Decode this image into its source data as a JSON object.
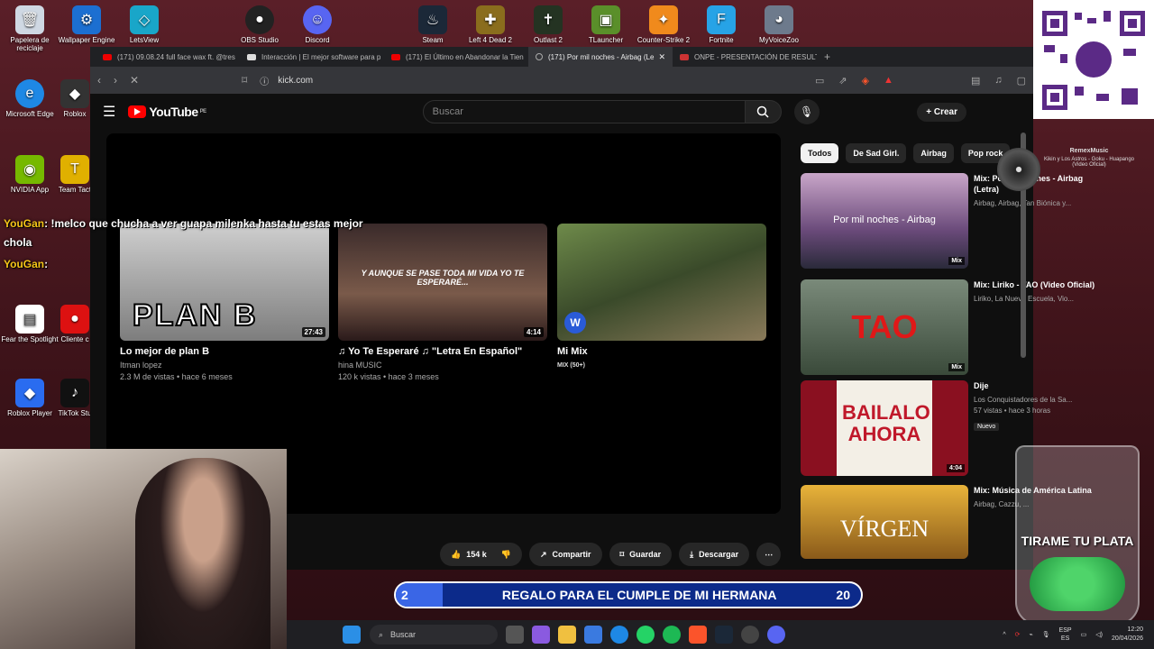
{
  "desktop": {
    "top_icons": [
      "Papelera de reciclaje",
      "Wallpaper Engine",
      "LetsView",
      "OBS Studio",
      "Discord",
      "Steam",
      "Left 4 Dead 2",
      "Outlast 2",
      "TLauncher",
      "Counter-Strike 2",
      "Fortnite",
      "MyVoiceZoo"
    ],
    "left_icons": [
      "Microsoft Edge",
      "Roblox",
      "NVIDIA App",
      "Team Tact",
      "Fear the Spotlight",
      "Cliente c",
      "Roblox Player",
      "TikTok Stu"
    ]
  },
  "browser": {
    "tabs": [
      "(171) 09.08.24 full face wax ft. @tres",
      "Interacción | El mejor software para p",
      "(171) El Último en Abandonar la Tien",
      "(171) Por mil noches - Airbag (Le",
      "ONPE - PRESENTACIÓN DE RESULTAI"
    ],
    "active_tab": 3,
    "url": "kick.com"
  },
  "youtube": {
    "logo": "YouTube",
    "region": "PE",
    "search_placeholder": "Buscar",
    "create_label": "Crear",
    "endcards": [
      {
        "title": "Lo mejor de plan B",
        "channel": "Itman lopez",
        "meta": "2.3 M de vistas • hace 6 meses",
        "duration": "27:43",
        "thumb_text": "PLAN B"
      },
      {
        "title": "♫ Yo Te Esperaré ♫ \"Letra En Español\"",
        "channel": "hina MUSIC",
        "meta": "120 k vistas • hace 3 meses",
        "duration": "4:14",
        "thumb_text": "Y AUNQUE SE PASE TODA MI VIDA YO TE ESPERARÉ..."
      },
      {
        "title": "Mi Mix",
        "channel": "MIX (50+)",
        "meta": "",
        "duration": "",
        "thumb_text": ""
      }
    ],
    "actions": {
      "likes": "154 k",
      "share": "Compartir",
      "save": "Guardar",
      "download": "Descargar"
    },
    "chips": [
      "Todos",
      "De Sad Girl.",
      "Airbag",
      "Pop rock"
    ],
    "related": [
      {
        "title": "Mix: Por mil noches - Airbag (Letra)",
        "meta": "Airbag, Airbag, Tan Biónica y...",
        "tag": "Mix",
        "thumb_text": "Por mil noches - Airbag"
      },
      {
        "title": "Mix: Liriko - TAO (Video Oficial)",
        "meta": "Liriko, La Nueva Escuela, Vio...",
        "tag": "Mix",
        "thumb_text": "TAO"
      },
      {
        "title": "Dije",
        "meta": "Los Conquistadores de la Sa...",
        "meta2": "57 vistas • hace 3 horas",
        "badge": "Nuevo",
        "tag": "4:04",
        "thumb_text": "BAILALO AHORA"
      },
      {
        "title": "Mix: Música de América Latina",
        "meta": "Airbag, Cazzu, ...",
        "tag": "",
        "thumb_text": "VÍRGEN"
      }
    ]
  },
  "overlay": {
    "chat1_name": "YouGan",
    "chat1_text": ": !melco que chucha a ver guapa milenka hasta tu estas mejor",
    "chat2_text": "chola",
    "chat3_name": "YouGan",
    "chat3_text": ":",
    "remex_title": "RemexMusic",
    "remex_song": "Kikin y Los Astros - Goku - Huapango (Video Oficial)",
    "goal_current": "2",
    "goal_text": "REGALO PARA EL CUMPLE DE MI HERMANA",
    "goal_target": "20",
    "progress_fraction": 0.1,
    "jar_text": "TIRAME TU PLATA"
  },
  "taskbar": {
    "search": "Buscar",
    "lang": "ESP",
    "lang2": "ES",
    "time": "12:20",
    "date": "20/04/2026"
  }
}
